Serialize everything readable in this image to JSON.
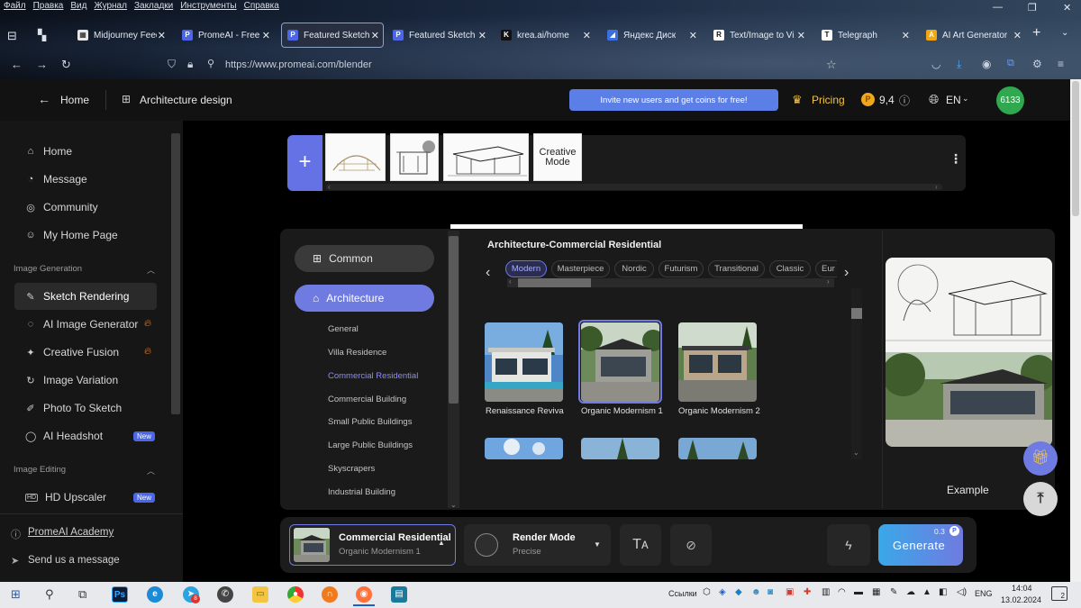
{
  "browser": {
    "menu": [
      "Файл",
      "Правка",
      "Вид",
      "Журнал",
      "Закладки",
      "Инструменты",
      "Справка"
    ],
    "tabs": [
      {
        "label": "Midjourney Feed",
        "fav": "#e8e8e8",
        "glyph": "▦"
      },
      {
        "label": "PromeAI - Free AI",
        "fav": "#4b67e8",
        "glyph": "P"
      },
      {
        "label": "Featured Sketch R",
        "fav": "#4b67e8",
        "glyph": "P"
      },
      {
        "label": "Featured Sketch R",
        "fav": "#4b67e8",
        "glyph": "P"
      },
      {
        "label": "krea.ai/home",
        "fav": "#111",
        "glyph": "K"
      },
      {
        "label": "Яндекс Диск",
        "fav": "#3a6fe0",
        "glyph": "◢"
      },
      {
        "label": "Text/Image to Vi",
        "fav": "#fff",
        "glyph": "R"
      },
      {
        "label": "Telegraph",
        "fav": "#fff",
        "glyph": "T"
      },
      {
        "label": "AI Art Generator",
        "fav": "#f2a60f",
        "glyph": "A"
      }
    ],
    "url": "https://www.promeai.com/blender"
  },
  "header": {
    "home": "Home",
    "section": "Architecture design",
    "invite": "Invite new users and get coins for free!",
    "pricing": "Pricing",
    "coins": "9,4",
    "lang": "EN",
    "avatar": "6133"
  },
  "sidebar": {
    "items": [
      {
        "label": "Home",
        "icon": "home-icon",
        "glyph": "⌂"
      },
      {
        "label": "Message",
        "icon": "bell-icon",
        "glyph": "◔"
      },
      {
        "label": "Community",
        "icon": "compass-icon",
        "glyph": "◎"
      },
      {
        "label": "My Home Page",
        "icon": "user-icon",
        "glyph": "☺"
      }
    ],
    "section_gen": "Image Generation",
    "gen_items": [
      {
        "label": "Sketch Rendering",
        "glyph": "✎"
      },
      {
        "label": "AI Image Generator",
        "glyph": "◌"
      },
      {
        "label": "Creative Fusion",
        "glyph": "✦"
      },
      {
        "label": "Image Variation",
        "glyph": "↻"
      },
      {
        "label": "Photo To Sketch",
        "glyph": "✐"
      },
      {
        "label": "AI Headshot",
        "glyph": "◯"
      }
    ],
    "section_edit": "Image Editing",
    "edit_items": [
      {
        "label": "HD Upscaler",
        "glyph": "HD"
      }
    ],
    "academy": "PromeAI Academy",
    "send": "Send us a message",
    "new_badge": "New"
  },
  "strip": {
    "creative": "Creative Mode"
  },
  "panel": {
    "common": "Common",
    "architecture": "Architecture",
    "subs": [
      "General",
      "Villa Residence",
      "Commercial Residential",
      "Commercial Building",
      "Small Public Buildings",
      "Large Public Buildings",
      "Skyscrapers",
      "Industrial Building"
    ],
    "title": "Architecture-Commercial Residential",
    "styles": [
      "Modern",
      "Masterpiece",
      "Nordic",
      "Futurism",
      "Transitional",
      "Classic",
      "Eur"
    ],
    "cards": [
      "Renaissance Reviva",
      "Organic Modernism 1",
      "Organic Modernism 2"
    ],
    "example": "Example"
  },
  "bottom": {
    "selected_title": "Commercial Residential",
    "selected_sub": "Organic Modernism 1",
    "render_title": "Render Mode",
    "render_sub": "Precise",
    "cost": "0.3",
    "generate": "Generate"
  },
  "taskbar": {
    "links": "Ссылки",
    "lang": "ENG",
    "time": "14:04",
    "date": "13.02.2024",
    "notif": "2"
  }
}
